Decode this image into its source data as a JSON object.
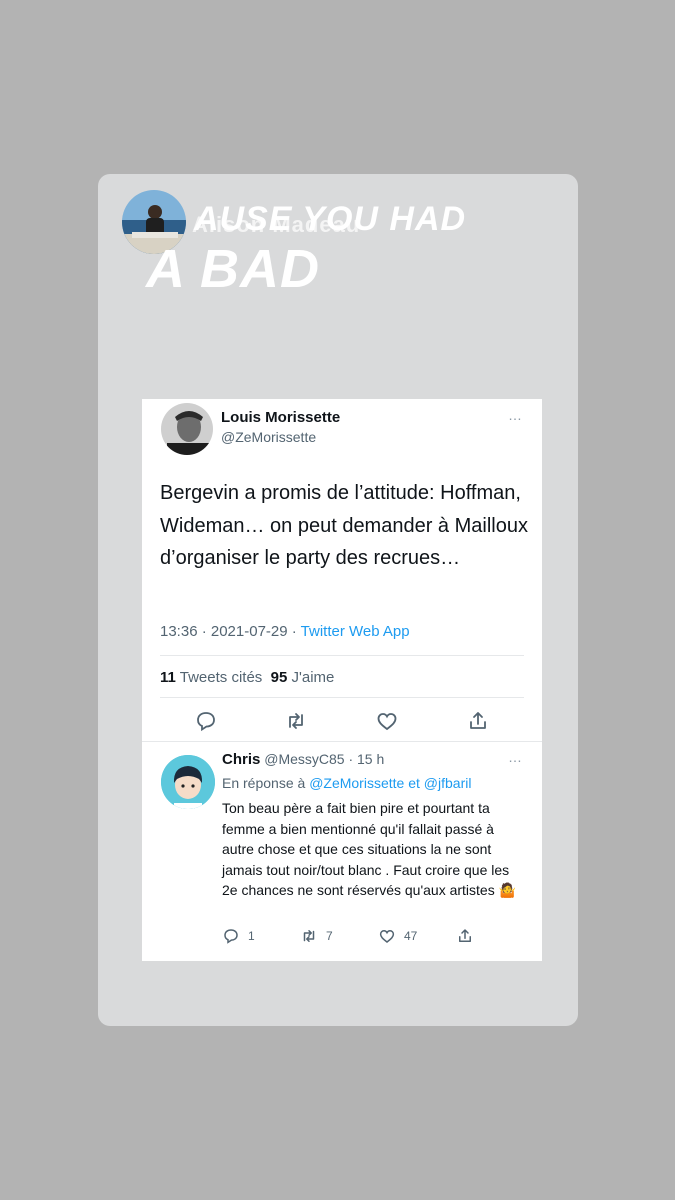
{
  "story": {
    "overlay_faint_text": "Alison Madeau",
    "overlay_line1": "AUSE YOU HAD",
    "overlay_line2": "A BAD"
  },
  "tweet": {
    "author_name": "Louis Morissette",
    "author_handle": "@ZeMorissette",
    "text": "Bergevin a promis de l’attitude: Hoffman, Wideman… on peut demander à Mailloux d’organiser le party des recrues…",
    "time": "13:36 · 2021-07-29 · ",
    "source": "Twitter Web App",
    "quote_count": "11",
    "quote_label": "Tweets cités",
    "like_count": "95",
    "like_label": "J'aime",
    "more_icon": "…"
  },
  "reply": {
    "author_name": "Chris",
    "author_handle": "@MessyC85",
    "time": "· 15 h",
    "reply_prefix": "En réponse à",
    "mention1": "@ZeMorissette",
    "and_word": "et",
    "mention2": "@jfbaril",
    "text": "Ton beau père a fait bien pire et pourtant ta femme a bien mentionné qu'il fallait passé à autre chose et que ces situations la ne sont jamais tout noir/tout blanc  . Faut croire que les 2e chances ne sont réservés qu'aux artistes 🤷",
    "reply_count": "1",
    "retweet_count": "7",
    "like_count": "47",
    "more_icon": "…"
  },
  "colors": {
    "link": "#1d9bf0",
    "muted": "#536471",
    "text": "#0f1419"
  }
}
